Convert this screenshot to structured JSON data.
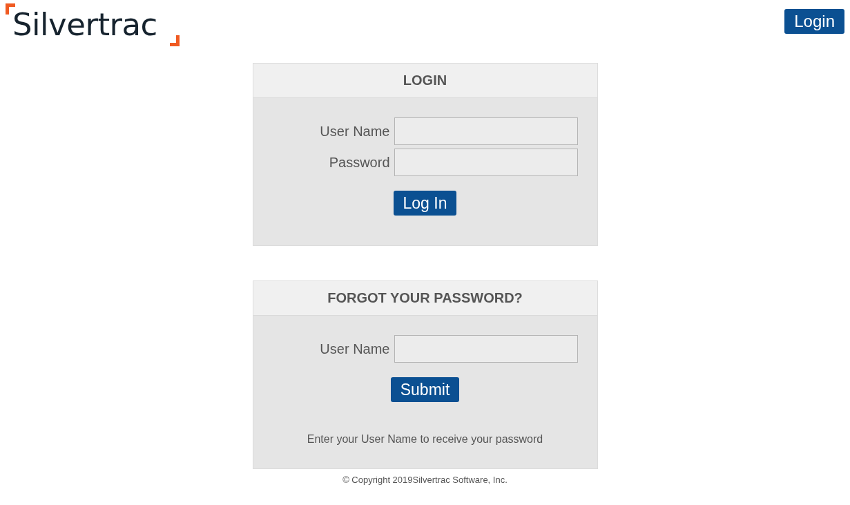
{
  "header": {
    "logo": "Silvertrac",
    "login_button": "Login"
  },
  "panels": [
    {
      "title": "LOGIN",
      "fields": [
        {
          "label": "User Name"
        },
        {
          "label": "Password"
        }
      ],
      "button": "Log In"
    },
    {
      "title": "FORGOT YOUR PASSWORD?",
      "fields": [
        {
          "label": "User Name"
        }
      ],
      "button": "Submit",
      "note": "Enter your User Name to receive your password"
    }
  ],
  "footer": "© Copyright 2019Silvertrac Software, Inc."
}
